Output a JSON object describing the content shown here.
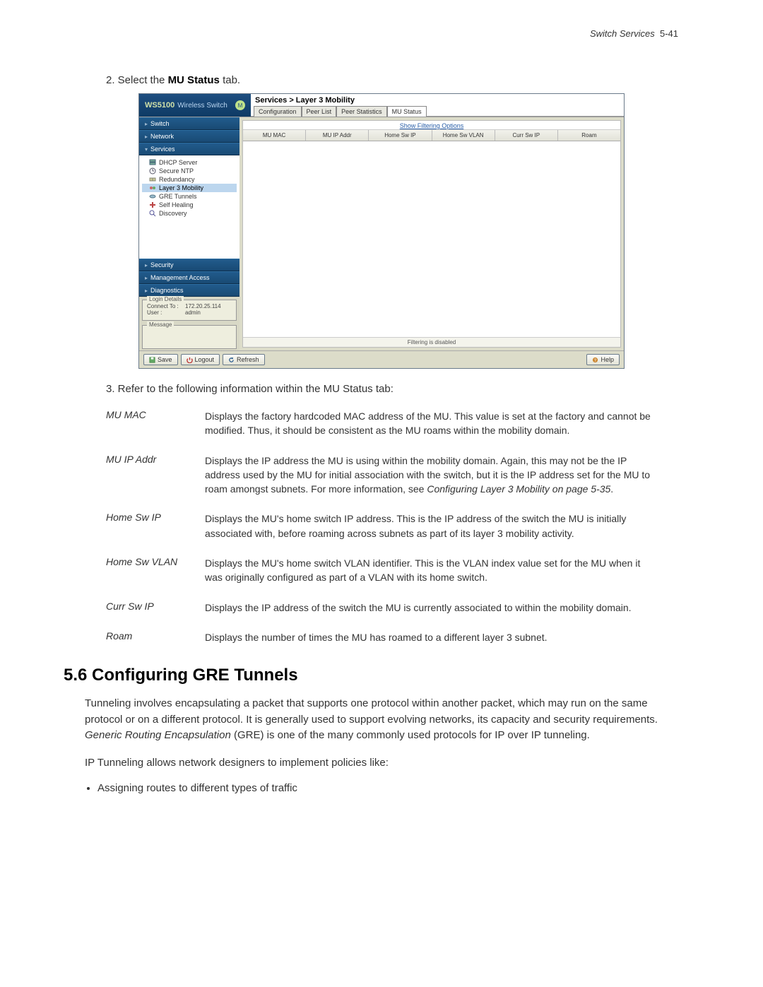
{
  "header": {
    "title_italic": "Switch Services",
    "pageref": "5-41"
  },
  "step2": {
    "prefix": "2. Select the ",
    "bold": "MU Status",
    "suffix": " tab."
  },
  "app": {
    "title_ws": "WS5100",
    "title_sub": "Wireless Switch",
    "logo_text": "M",
    "breadcrumb": "Services > Layer 3 Mobility",
    "tabs": [
      "Configuration",
      "Peer List",
      "Peer Statistics",
      "MU Status"
    ],
    "active_tab_index": 3,
    "sidebar": {
      "items": [
        "Switch",
        "Network",
        "Services",
        "Security",
        "Management Access",
        "Diagnostics"
      ],
      "tree": [
        "DHCP Server",
        "Secure NTP",
        "Redundancy",
        "Layer 3 Mobility",
        "GRE Tunnels",
        "Self Healing",
        "Discovery"
      ],
      "tree_selected_index": 3
    },
    "login": {
      "legend": "Login Details",
      "connect_label": "Connect To :",
      "connect_val": "172.20.25.114",
      "user_label": "User :",
      "user_val": "admin"
    },
    "message_legend": "Message",
    "content": {
      "filter_link": "Show Filtering Options",
      "columns": [
        "MU MAC",
        "MU IP Addr",
        "Home Sw IP",
        "Home Sw VLAN",
        "Curr Sw IP",
        "Roam"
      ],
      "footer": "Filtering is disabled"
    },
    "buttons": {
      "save": "Save",
      "logout": "Logout",
      "refresh": "Refresh",
      "help": "Help"
    }
  },
  "step3": "3. Refer to the following information within the MU Status tab:",
  "defs": [
    {
      "term": "MU MAC",
      "desc": "Displays the factory hardcoded MAC address of the MU. This value is set at the factory and cannot be modified. Thus, it should be consistent as the MU roams within the mobility domain."
    },
    {
      "term": "MU IP Addr",
      "desc_pre": "Displays the IP address the MU is using within the mobility domain. Again, this may not be the IP address used by the MU for initial association with the switch, but it is the IP address set for the MU to roam amongst subnets. For more information, see ",
      "desc_ital": "Configuring Layer 3 Mobility on page 5-35",
      "desc_post": "."
    },
    {
      "term": "Home Sw IP",
      "desc": "Displays the MU's home switch IP address. This is the IP address of the switch the MU is initially associated with, before roaming across subnets as part of its layer 3 mobility activity."
    },
    {
      "term": "Home Sw VLAN",
      "desc": "Displays the MU's home switch VLAN identifier. This is the VLAN index value set for the MU when it was originally configured as part of a VLAN with its home switch."
    },
    {
      "term": "Curr Sw IP",
      "desc": "Displays the IP address of the switch the MU is currently associated to within the mobility domain."
    },
    {
      "term": "Roam",
      "desc": "Displays the number of times the MU has roamed to a different layer 3 subnet."
    }
  ],
  "section": {
    "num": "5.6",
    "title": "Configuring GRE Tunnels"
  },
  "para1_pre": "Tunneling involves encapsulating a packet that supports one protocol within another packet, which may run on the same protocol or on a different protocol. It is generally used to support evolving networks, its capacity and security requirements. ",
  "para1_ital": "Generic Routing Encapsulation",
  "para1_post": " (GRE) is one of the many commonly used protocols for IP over IP tunneling.",
  "para2": "IP Tunneling allows network designers to implement policies like:",
  "bullet1": "Assigning routes to different types of traffic"
}
